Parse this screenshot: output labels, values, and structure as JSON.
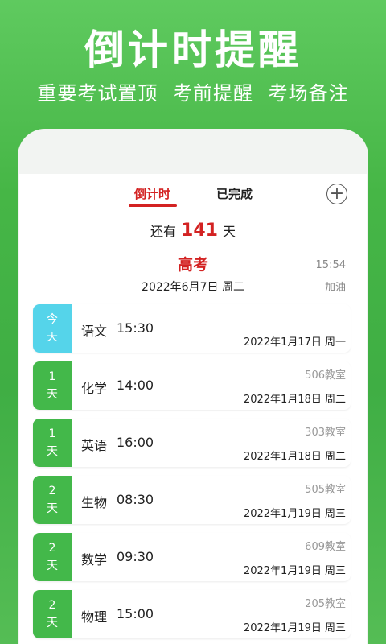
{
  "hero": {
    "title": "倒计时提醒",
    "subtitle": "重要考试置顶 考前提醒 考场备注"
  },
  "tabs": [
    {
      "label": "倒计时",
      "active": true
    },
    {
      "label": "已完成",
      "active": false
    }
  ],
  "add_icon": "plus-circle-icon",
  "countdown": {
    "prefix": "还有",
    "days": "141",
    "suffix": "天",
    "exam": "高考",
    "date": "2022年6月7日 周二",
    "time": "15:54",
    "note": "加油"
  },
  "colors": {
    "accent_red": "#d32222",
    "badge_green": "#43b84a",
    "badge_today": "#55d4ea",
    "background_green": "#46b646"
  },
  "exams": [
    {
      "badge_top": "今",
      "badge_bottom": "天",
      "subject": "语文",
      "time": "15:30",
      "room": "",
      "date": "2022年1月17日 周一",
      "today": true
    },
    {
      "badge_top": "1",
      "badge_bottom": "天",
      "subject": "化学",
      "time": "14:00",
      "room": "506教室",
      "date": "2022年1月18日 周二",
      "today": false
    },
    {
      "badge_top": "1",
      "badge_bottom": "天",
      "subject": "英语",
      "time": "16:00",
      "room": "303教室",
      "date": "2022年1月18日 周二",
      "today": false
    },
    {
      "badge_top": "2",
      "badge_bottom": "天",
      "subject": "生物",
      "time": "08:30",
      "room": "505教室",
      "date": "2022年1月19日 周三",
      "today": false
    },
    {
      "badge_top": "2",
      "badge_bottom": "天",
      "subject": "数学",
      "time": "09:30",
      "room": "609教室",
      "date": "2022年1月19日 周三",
      "today": false
    },
    {
      "badge_top": "2",
      "badge_bottom": "天",
      "subject": "物理",
      "time": "15:00",
      "room": "205教室",
      "date": "2022年1月19日 周三",
      "today": false
    }
  ]
}
